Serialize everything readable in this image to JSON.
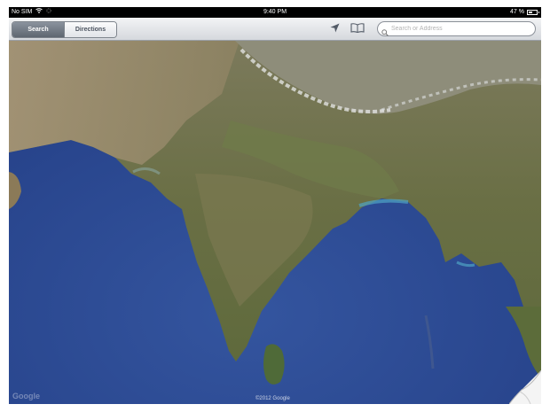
{
  "status_bar": {
    "carrier": "No SIM",
    "time": "9:40 PM",
    "battery_text": "47 %",
    "battery_level": 0.47
  },
  "toolbar": {
    "tabs": [
      {
        "label": "Search",
        "active": true
      },
      {
        "label": "Directions",
        "active": false
      }
    ],
    "location_icon": "location-arrow-icon",
    "bookmarks_icon": "book-icon",
    "search": {
      "placeholder": "Search or Address",
      "value": ""
    }
  },
  "map": {
    "watermark": "Google",
    "copyright": "©2012 Google",
    "ocean_color": "#2e4f98",
    "land_color": "#6d7448"
  }
}
